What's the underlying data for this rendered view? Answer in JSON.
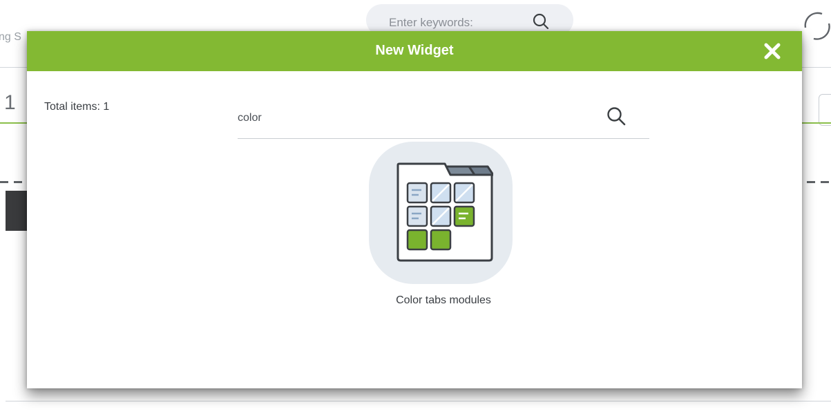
{
  "background": {
    "search_placeholder": "Enter keywords:",
    "left_fragment": "ng S",
    "left_number": "1"
  },
  "modal": {
    "title": "New Widget",
    "total_items": "Total items: 1",
    "search": {
      "value": "color",
      "placeholder": ""
    },
    "widgets": [
      {
        "label": "Color tabs modules",
        "icon": "color-tabs-grid-icon"
      }
    ]
  },
  "colors": {
    "header_green": "#83b933",
    "accent_green": "#7ab32e",
    "icon_bubble": "#e6ebf0"
  }
}
